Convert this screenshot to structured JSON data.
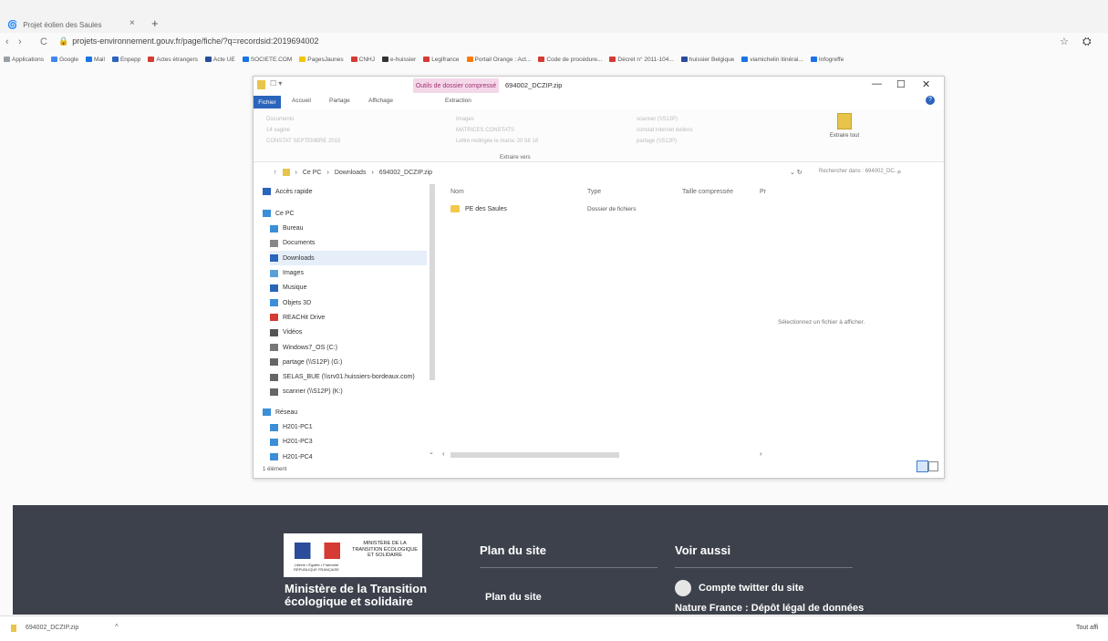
{
  "browser": {
    "tab_title": "Projet éolien des Saules",
    "tab_close": "×",
    "new_tab": "+",
    "back": "‹",
    "forward": "›",
    "reload": "C",
    "url": "projets-environnement.gouv.fr/page/fiche/?q=recordsid:2019694002",
    "bookmarks": [
      {
        "label": "Applications",
        "color": "#9aa0a6"
      },
      {
        "label": "Google",
        "color": "#4285f4"
      },
      {
        "label": "Mail",
        "color": "#1a73e8"
      },
      {
        "label": "Enpepp",
        "color": "#2a64bb"
      },
      {
        "label": "Actes étrangers",
        "color": "#d53a33"
      },
      {
        "label": "Acte UE",
        "color": "#2a4c9a"
      },
      {
        "label": "SOCIETE.COM",
        "color": "#1a73e8"
      },
      {
        "label": "PagesJaunes",
        "color": "#f2c500"
      },
      {
        "label": "CNHJ",
        "color": "#d53a33"
      },
      {
        "label": "e-huissier",
        "color": "#333"
      },
      {
        "label": "Legifrance",
        "color": "#d53a33"
      },
      {
        "label": "Portail Orange : Act...",
        "color": "#ff7900"
      },
      {
        "label": "Code de procédure...",
        "color": "#d53a33"
      },
      {
        "label": "Décret n° 2011-104...",
        "color": "#d53a33"
      },
      {
        "label": "huissier Belgique",
        "color": "#2a4c9a"
      },
      {
        "label": "viamichelin itinérai...",
        "color": "#1a73e8"
      },
      {
        "label": "Infogreffe",
        "color": "#1a73e8"
      }
    ]
  },
  "explorer": {
    "context_tab": "Outils de dossier compressé",
    "window_name": "694002_DCZIP.zip",
    "minimize": "—",
    "maximize": "☐",
    "close": "✕",
    "ribbon_tabs": [
      "Fichier",
      "Accueil",
      "Partage",
      "Affichage",
      "Extraction"
    ],
    "ribbon_items": [
      "Documents",
      "14 vagine",
      "CONSTAT SEPTEMBRE 2015",
      "Images",
      "MATRICES CONSTATS",
      "Lettre redirigée le maroc 20 58 18",
      "scanner (\\\\S12P)",
      "constat internet éoliens",
      "partage (\\\\S12P)"
    ],
    "extract_all": "Extraire tout",
    "extract_to": "Extraire vers",
    "path": [
      "Ce PC",
      "Downloads",
      "694002_DCZIP.zip"
    ],
    "search_placeholder": "Rechercher dans : 694002_DC...",
    "nav": [
      {
        "label": "Accès rapide",
        "color": "#2a64bb"
      },
      {
        "label": "Ce PC",
        "color": "#3a8fd8"
      },
      {
        "label": "Bureau",
        "color": "#3a8fd8"
      },
      {
        "label": "Documents",
        "color": "#888"
      },
      {
        "label": "Downloads",
        "color": "#2a64bb"
      },
      {
        "label": "Images",
        "color": "#5aa0d8"
      },
      {
        "label": "Musique",
        "color": "#2a64bb"
      },
      {
        "label": "Objets 3D",
        "color": "#3a8fd8"
      },
      {
        "label": "REACHit Drive",
        "color": "#d53a33"
      },
      {
        "label": "Vidéos",
        "color": "#555"
      },
      {
        "label": "Windows7_OS (C:)",
        "color": "#777"
      },
      {
        "label": "partage (\\\\S12P) (G:)",
        "color": "#666"
      },
      {
        "label": "SELAS_BUE (\\\\srv01.huissiers-bordeaux.com)",
        "color": "#666"
      },
      {
        "label": "scanner (\\\\S12P) (K:)",
        "color": "#666"
      },
      {
        "label": "Réseau",
        "color": "#3a8fd8"
      },
      {
        "label": "H201-PC1",
        "color": "#3a8fd8"
      },
      {
        "label": "H201-PC3",
        "color": "#3a8fd8"
      },
      {
        "label": "H201-PC4",
        "color": "#3a8fd8"
      }
    ],
    "columns": [
      "Nom",
      "Type",
      "Taille compressée",
      "Pr"
    ],
    "files": [
      {
        "name": "PE des Saules",
        "type": "Dossier de fichiers"
      }
    ],
    "preview_message": "Sélectionnez un fichier à afficher.",
    "status": "1 élément"
  },
  "footer": {
    "logo_ministere": "MINISTÈRE DE LA TRANSITION ÉCOLOGIQUE ET SOLIDAIRE",
    "logo_tagline": "Liberté • Égalité • Fraternité RÉPUBLIQUE FRANÇAISE",
    "ministry_name": "Ministère de la Transition écologique et solidaire",
    "plan_title": "Plan du site",
    "plan_link": "Plan du site",
    "voir_title": "Voir aussi",
    "twitter_link": "Compte twitter du site",
    "cut_link": "Nature France : Dépôt légal de données"
  },
  "download": {
    "file": "694002_DCZIP.zip",
    "chevron": "^",
    "show_all": "Tout affi"
  }
}
